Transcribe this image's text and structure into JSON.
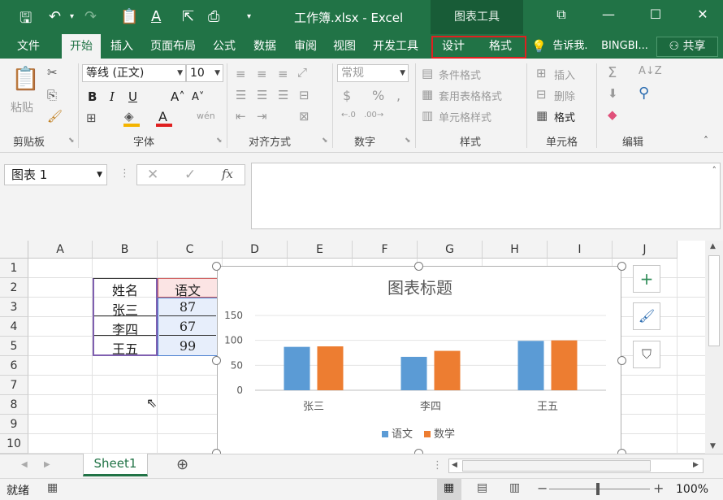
{
  "titlebar": {
    "title": "工作簿.xlsx - Excel",
    "tools_tab": "图表工具"
  },
  "tabs": [
    {
      "label": "文件"
    },
    {
      "label": "开始"
    },
    {
      "label": "插入"
    },
    {
      "label": "页面布局"
    },
    {
      "label": "公式"
    },
    {
      "label": "数据"
    },
    {
      "label": "审阅"
    },
    {
      "label": "视图"
    },
    {
      "label": "开发工具"
    },
    {
      "label": "设计"
    },
    {
      "label": "格式"
    }
  ],
  "tellme": "告诉我.",
  "user": "BINGBI...",
  "share": "共享",
  "ribbon": {
    "paste": "粘贴",
    "font_name": "等线 (正文)",
    "font_size": "10",
    "number_format": "常规",
    "conditional_format": "条件格式",
    "table_format": "套用表格格式",
    "cell_style": "单元格样式",
    "insert": "插入",
    "delete": "删除",
    "format": "格式",
    "groups": {
      "clipboard": "剪贴板",
      "font": "字体",
      "align": "对齐方式",
      "number": "数字",
      "styles": "样式",
      "cells": "单元格",
      "editing": "编辑"
    }
  },
  "namebox": "图表 1",
  "columns": [
    "A",
    "B",
    "C",
    "D",
    "E",
    "F",
    "G",
    "H",
    "I",
    "J"
  ],
  "rows": [
    "1",
    "2",
    "3",
    "4",
    "5",
    "6",
    "7",
    "8",
    "9",
    "10"
  ],
  "table": {
    "header_name": "姓名",
    "header_subject": "语文",
    "names": [
      "张三",
      "李四",
      "王五"
    ],
    "scores": [
      "87",
      "67",
      "99"
    ]
  },
  "chart_data": {
    "type": "bar",
    "title": "图表标题",
    "categories": [
      "张三",
      "李四",
      "王五"
    ],
    "series": [
      {
        "name": "语文",
        "values": [
          87,
          67,
          99
        ],
        "color": "#5b9bd5"
      },
      {
        "name": "数学",
        "values": [
          88,
          79,
          100
        ],
        "color": "#ed7d31"
      }
    ],
    "ylim": [
      0,
      150
    ],
    "yticks": [
      "0",
      "50",
      "100",
      "150"
    ],
    "legend_position": "bottom"
  },
  "sheet_tab": "Sheet1",
  "status": "就绪",
  "zoom": "100%",
  "colors": {
    "accent": "#217346",
    "highlight": "#e02020"
  }
}
